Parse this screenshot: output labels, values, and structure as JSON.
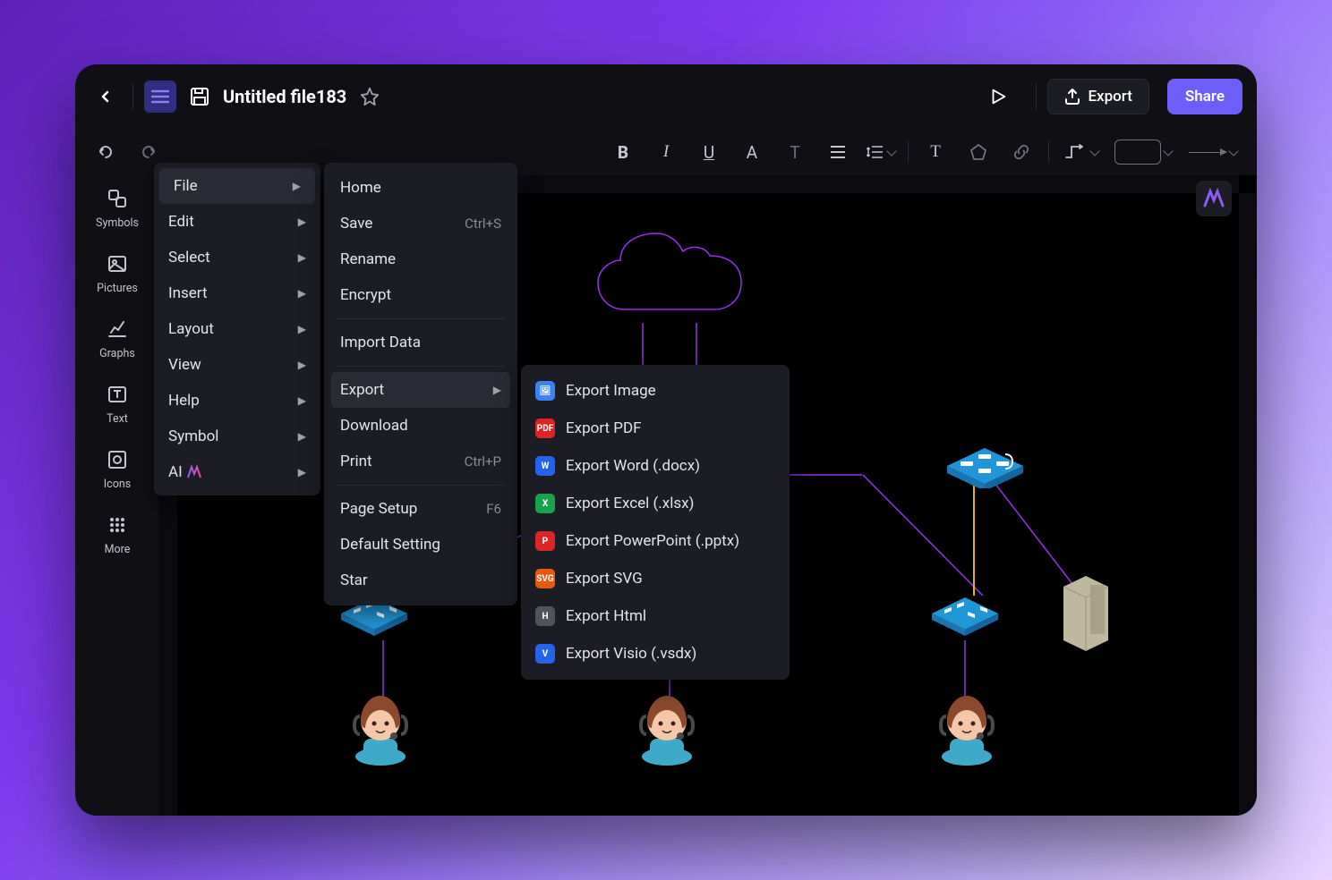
{
  "header": {
    "title": "Untitled file183",
    "export_label": "Export",
    "share_label": "Share"
  },
  "sidebar": {
    "items": [
      {
        "label": "Symbols"
      },
      {
        "label": "Pictures"
      },
      {
        "label": "Graphs"
      },
      {
        "label": "Text"
      },
      {
        "label": "Icons"
      },
      {
        "label": "More"
      }
    ]
  },
  "menu": {
    "items": [
      {
        "label": "File",
        "submenu": true,
        "highlighted": true
      },
      {
        "label": "Edit",
        "submenu": true
      },
      {
        "label": "Select",
        "submenu": true
      },
      {
        "label": "Insert",
        "submenu": true
      },
      {
        "label": "Layout",
        "submenu": true
      },
      {
        "label": "View",
        "submenu": true
      },
      {
        "label": "Help",
        "submenu": true
      },
      {
        "label": "Symbol",
        "submenu": true
      },
      {
        "label": "AI",
        "submenu": true
      }
    ]
  },
  "file_menu": {
    "items": [
      {
        "label": "Home"
      },
      {
        "label": "Save",
        "shortcut": "Ctrl+S"
      },
      {
        "label": "Rename"
      },
      {
        "label": "Encrypt"
      },
      {
        "separator": true
      },
      {
        "label": "Import Data"
      },
      {
        "separator": true
      },
      {
        "label": "Export",
        "submenu": true,
        "highlighted": true
      },
      {
        "label": "Download"
      },
      {
        "label": "Print",
        "shortcut": "Ctrl+P"
      },
      {
        "separator": true
      },
      {
        "label": "Page Setup",
        "shortcut": "F6"
      },
      {
        "label": "Default Setting"
      },
      {
        "label": "Star"
      }
    ]
  },
  "export_menu": {
    "items": [
      {
        "label": "Export Image",
        "icon_color": "#3B82F6",
        "icon_text": "🖼"
      },
      {
        "label": "Export PDF",
        "icon_color": "#DC2626",
        "icon_text": "PDF"
      },
      {
        "label": "Export Word (.docx)",
        "icon_color": "#2563EB",
        "icon_text": "W"
      },
      {
        "label": "Export Excel (.xlsx)",
        "icon_color": "#16A34A",
        "icon_text": "X"
      },
      {
        "label": "Export PowerPoint (.pptx)",
        "icon_color": "#DC2626",
        "icon_text": "P"
      },
      {
        "label": "Export SVG",
        "icon_color": "#EA580C",
        "icon_text": "SVG"
      },
      {
        "label": "Export Html",
        "icon_color": "#52525B",
        "icon_text": "H"
      },
      {
        "label": "Export Visio (.vsdx)",
        "icon_color": "#2563EB",
        "icon_text": "V"
      }
    ]
  }
}
